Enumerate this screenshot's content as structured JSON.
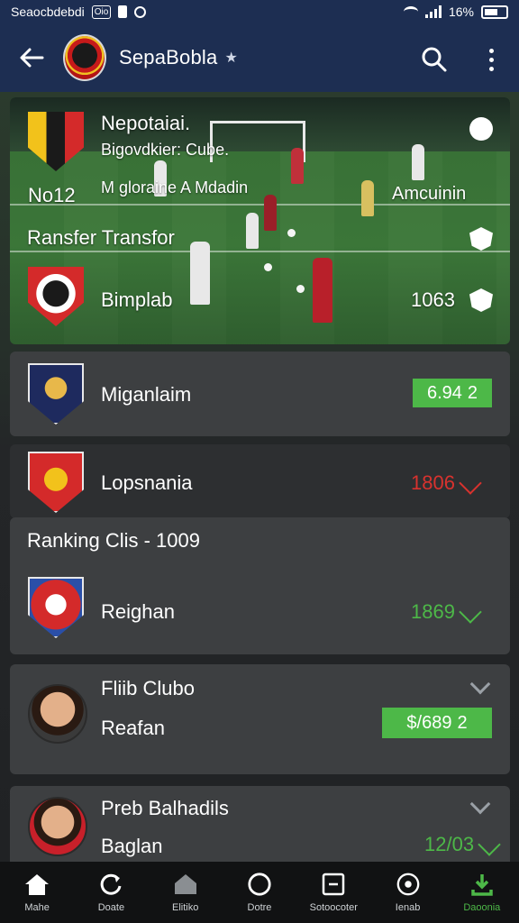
{
  "status_bar": {
    "left_text": "Seaocbdebdi",
    "badge_text": "Oio",
    "right_text": "16%"
  },
  "app_bar": {
    "title": "SepaBobla",
    "title_suffix": "★"
  },
  "hero": {
    "title": "Nepotaiai.",
    "subtitle": "Bigovdkier: Cube.",
    "left_label": "No12",
    "center_label": "M gloraine A Mdadin",
    "right_label": "Amcuinin",
    "transfer_label": "Ransfer Transfor",
    "club_name": "Bimplab",
    "club_value": "1063"
  },
  "clubs": [
    {
      "name": "Miganlaim",
      "value": "6.94",
      "value_suffix": "2",
      "style": "green-box"
    },
    {
      "name": "Lopsnania",
      "value": "1806",
      "style": "red"
    },
    {
      "name": "Reighan",
      "value": "1869",
      "style": "green"
    }
  ],
  "ranking_header": "Ranking Clis - 1009",
  "players": [
    {
      "title": "Fliib Clubo",
      "name": "Reafan",
      "value": "$/689",
      "value_suffix": "2",
      "style": "green-box"
    },
    {
      "title": "Preb Balhadils",
      "name": "Baglan",
      "value": "12/03",
      "style": "green"
    }
  ],
  "nav": [
    {
      "label": "Mahe",
      "icon": "home-icon",
      "active": false
    },
    {
      "label": "Doate",
      "icon": "refresh-icon",
      "active": false
    },
    {
      "label": "Elitiko",
      "icon": "stadium-icon",
      "active": false
    },
    {
      "label": "Dotre",
      "icon": "circle-icon",
      "active": false
    },
    {
      "label": "Sotoocoter",
      "icon": "card-icon",
      "active": false
    },
    {
      "label": "Ienab",
      "icon": "ball-icon",
      "active": false
    },
    {
      "label": "Daoonia",
      "icon": "download-icon",
      "active": true
    }
  ],
  "colors": {
    "app_bar": "#1d2e52",
    "accent_green": "#4db848",
    "accent_red": "#d8322e",
    "card_bg": "#3d3f41"
  }
}
